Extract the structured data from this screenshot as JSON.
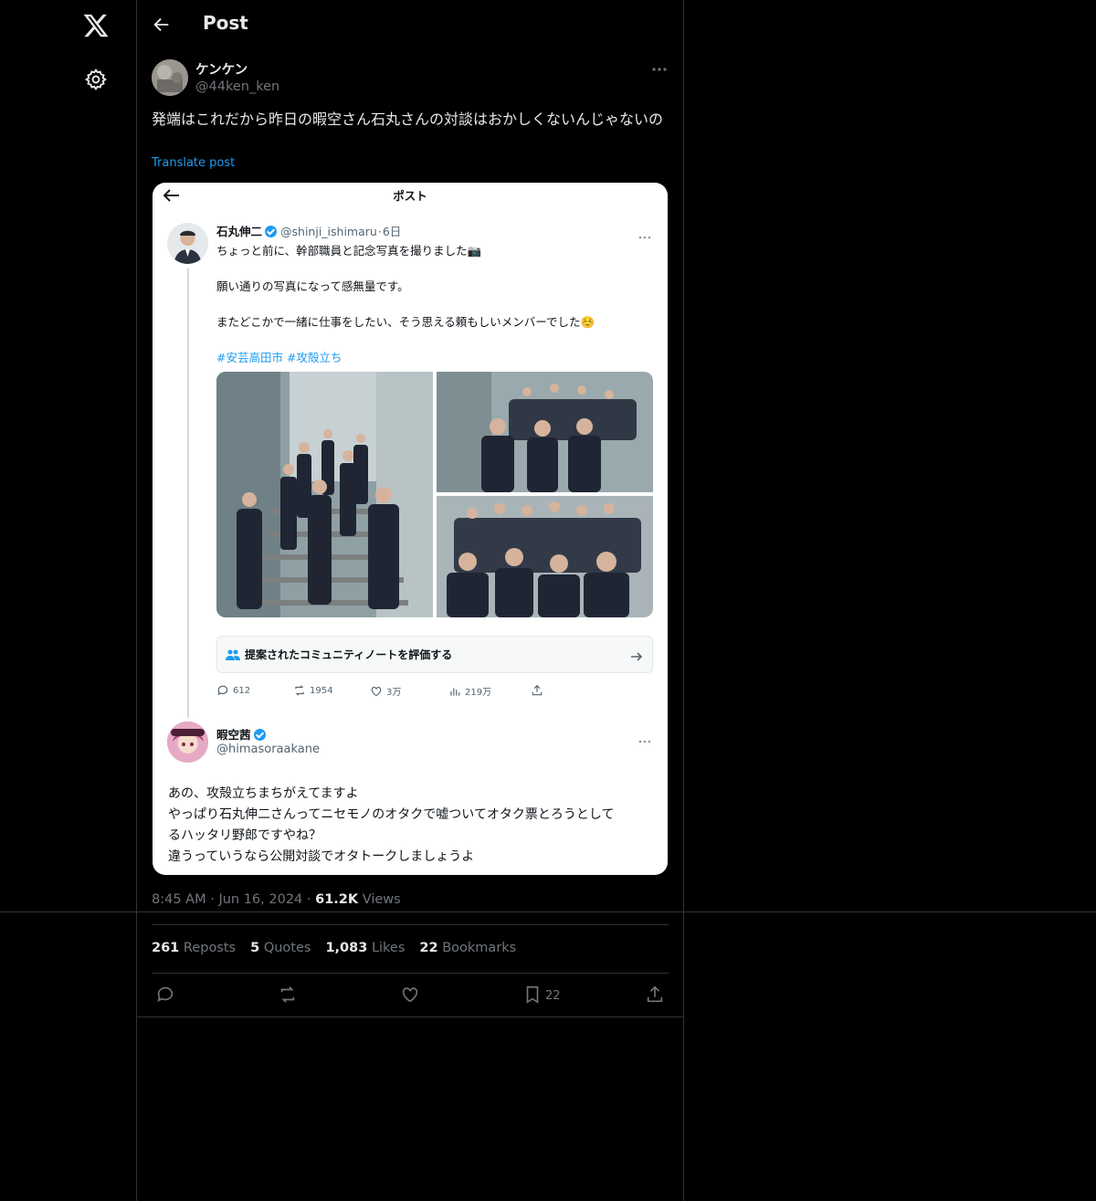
{
  "header": {
    "title": "Post"
  },
  "post": {
    "author_name": "ケンケン",
    "author_handle": "@44ken_ken",
    "text": "発端はこれだから昨日の暇空さん石丸さんの対談はおかしくないんじゃないの",
    "translate_label": "Translate post",
    "time": "8:45 AM",
    "date": "Jun 16, 2024",
    "views_count": "61.2K",
    "views_label": "Views"
  },
  "stats": {
    "reposts_count": "261",
    "reposts_label": "Reposts",
    "quotes_count": "5",
    "quotes_label": "Quotes",
    "likes_count": "1,083",
    "likes_label": "Likes",
    "bookmarks_count": "22",
    "bookmarks_label": "Bookmarks"
  },
  "actions": {
    "bookmark_count": "22"
  },
  "screenshot": {
    "title": "ポスト",
    "tweet1": {
      "name": "石丸伸二",
      "handle": "@shinji_ishimaru",
      "age": "6日",
      "line1": "ちょっと前に、幹部職員と記念写真を撮りました📷",
      "line2": "願い通りの写真になって感無量です。",
      "line3": "またどこかで一緒に仕事をしたい、そう思える頼もしいメンバーでした☺️",
      "hashtags": "#安芸高田市 #攻殻立ち"
    },
    "note": {
      "text": "提案されたコミュニティノートを評価する"
    },
    "tweet_stats": {
      "replies": "612",
      "reposts": "1954",
      "likes": "3万",
      "views": "219万"
    },
    "tweet2": {
      "name": "暇空茜",
      "handle": "@himasoraakane",
      "line1": "あの、攻殻立ちまちがえてますよ",
      "line2": "やっぱり石丸伸二さんってニセモノのオタクで嘘ついてオタク票とろうとして",
      "line3": "るハッタリ野郎ですやね？",
      "line4": "違うっていうなら公開対談でオタトークしましょうよ"
    }
  },
  "colors": {
    "background": "#000000",
    "text": "#e7e9ea",
    "muted": "#71767b",
    "accent": "#1d9bf0",
    "border": "#2f3336"
  }
}
